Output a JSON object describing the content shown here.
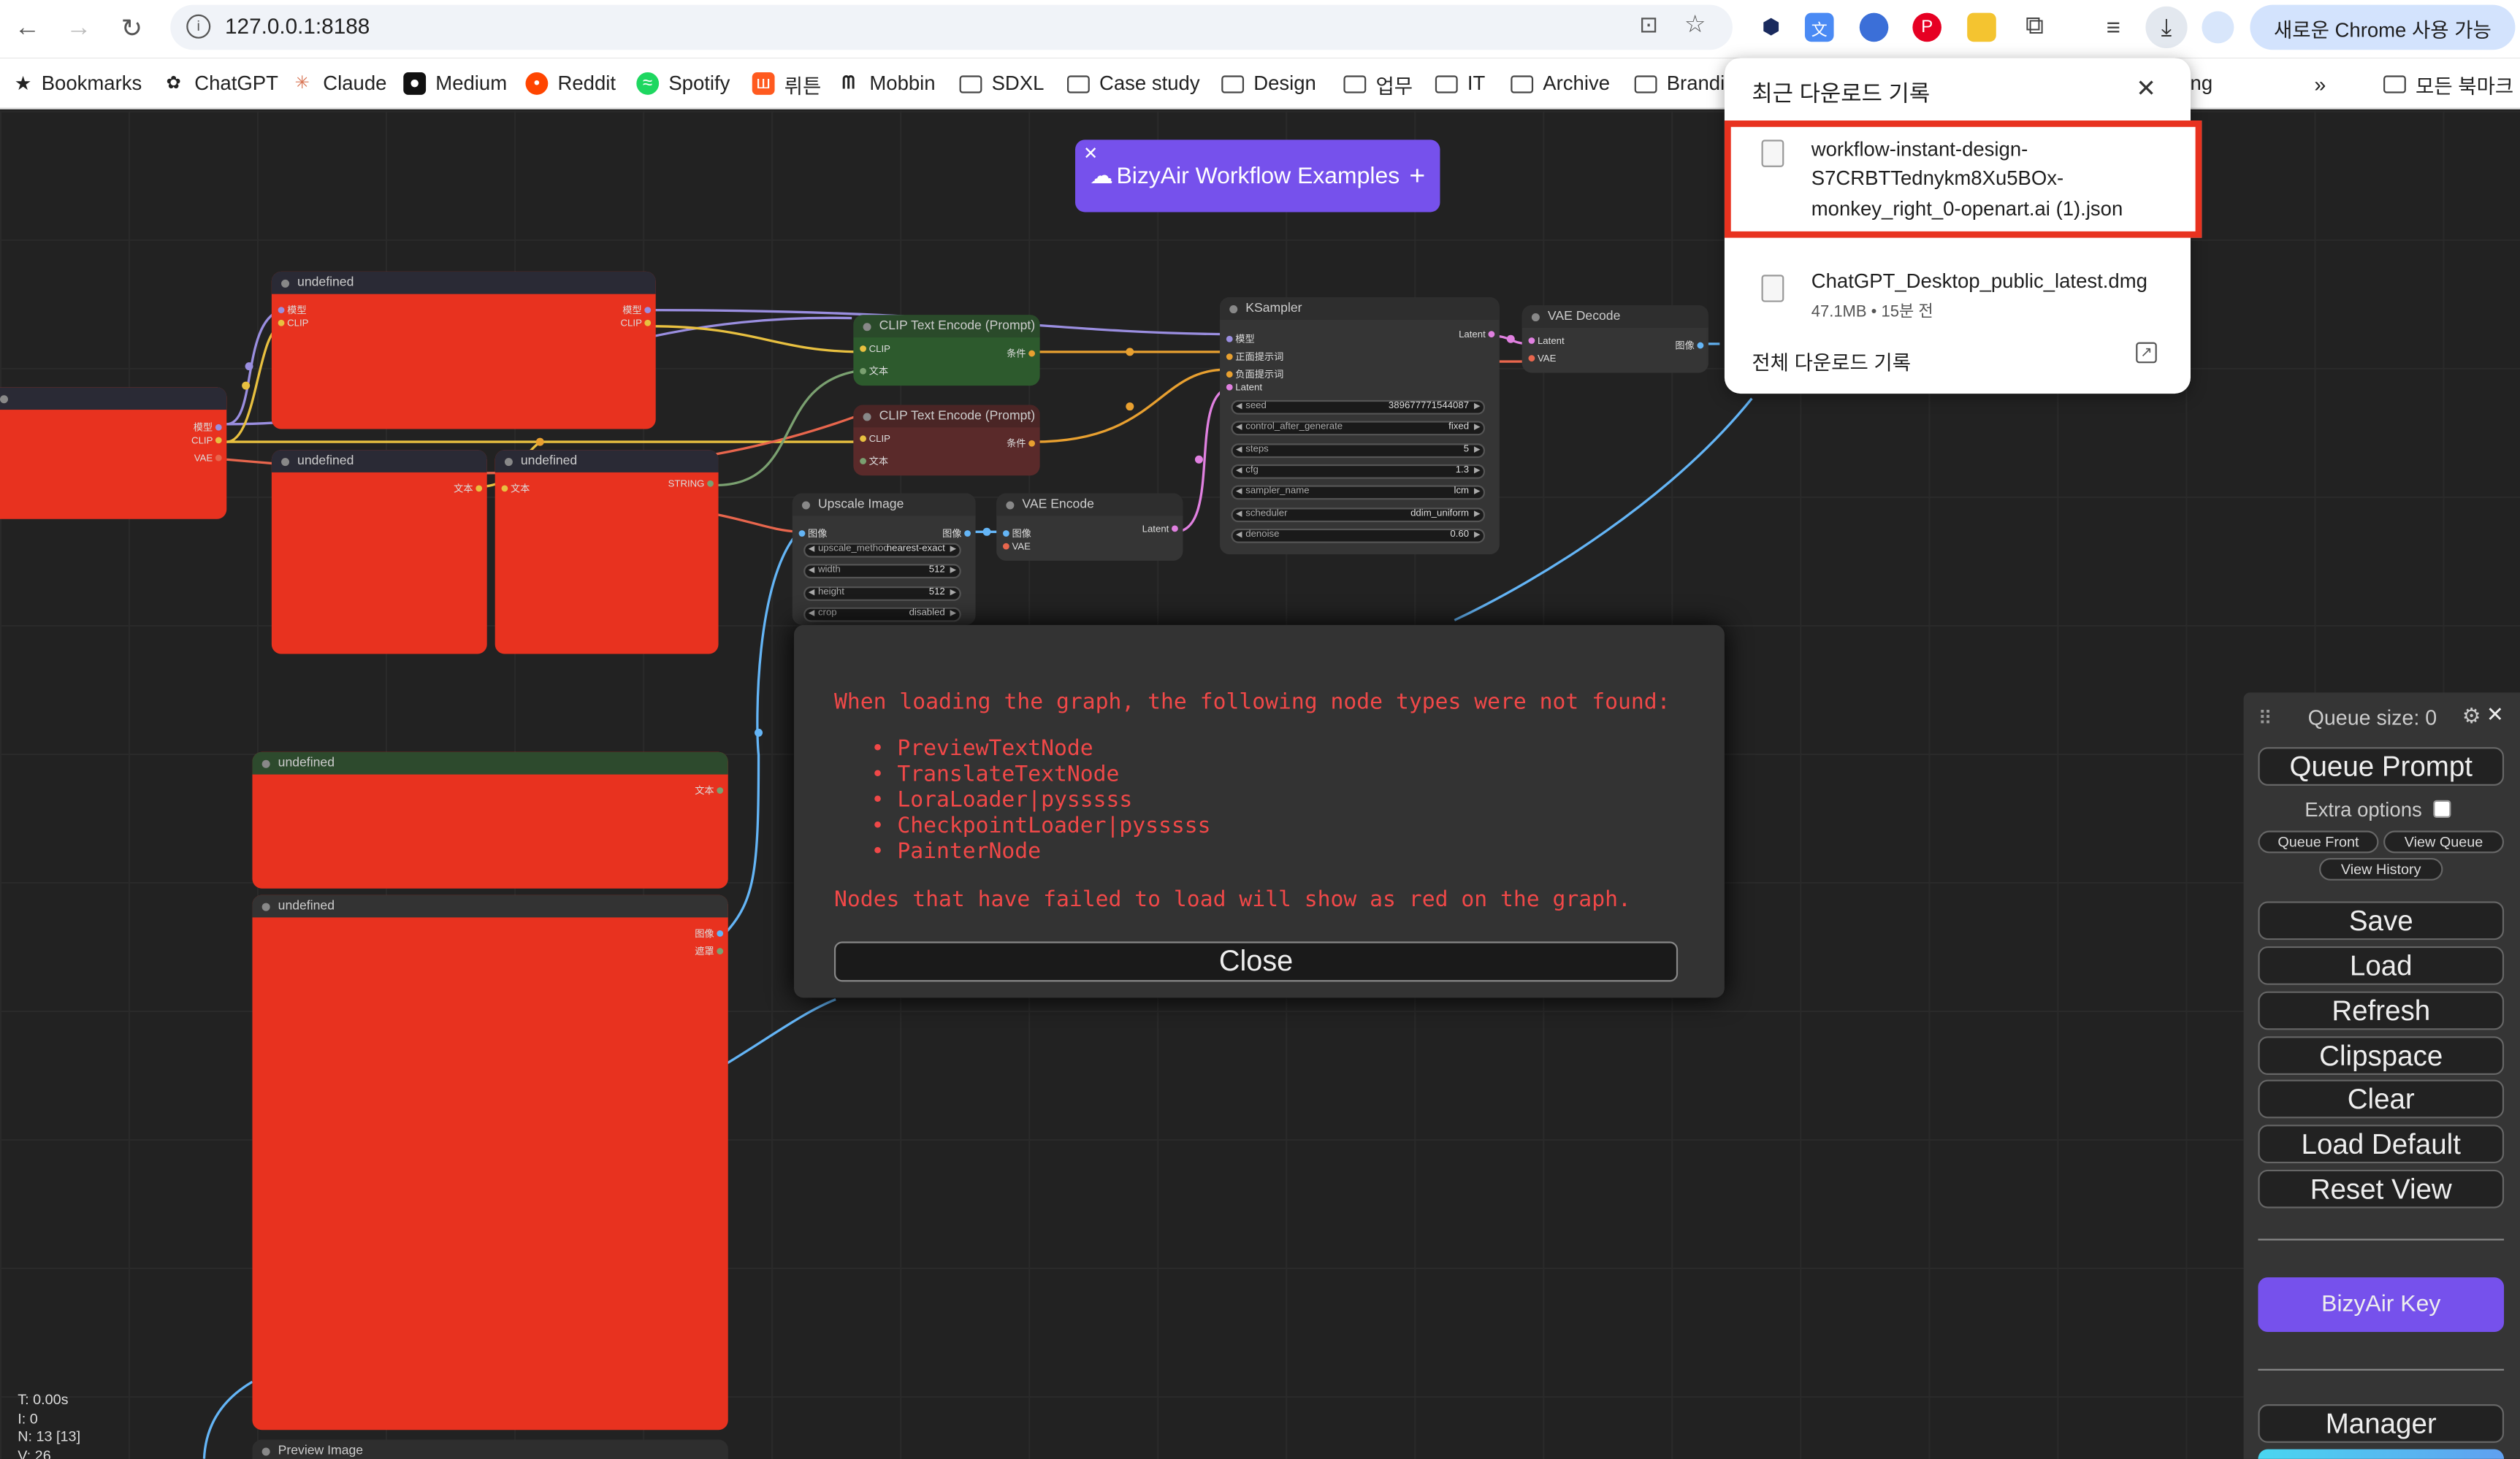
{
  "browser": {
    "url": "127.0.0.1:8188",
    "profile_button": "새로운 Chrome 사용 가능",
    "all_bookmarks": "모든 북마크",
    "bookmarks": [
      "Bookmarks",
      "ChatGPT",
      "Claude",
      "Medium",
      "Reddit",
      "Spotify",
      "뤼튼",
      "Mobbin",
      "SDXL",
      "Case study",
      "Design",
      "업무",
      "IT",
      "Archive",
      "Brandi",
      "ing"
    ]
  },
  "downloads": {
    "title": "최근 다운로드 기록",
    "items": [
      {
        "name_line1": "workflow-instant-design-",
        "name_line2": "S7CRBTTednykm8Xu5BOx-",
        "name_line3": "monkey_right_0-openart.ai (1).json",
        "meta": ""
      },
      {
        "name_line1": "ChatGPT_Desktop_public_latest.dmg",
        "meta": "47.1MB • 15분 전"
      }
    ],
    "all_history": "전체 다운로드 기록",
    "highlight_color": "#e8321f"
  },
  "bizyair": {
    "label": "BizyAir Workflow Examples"
  },
  "nodes": {
    "undef": "undefined",
    "clip_encode": "CLIP Text Encode (Prompt)",
    "ksampler": "KSampler",
    "vae_decode": "VAE Decode",
    "upscale": "Upscale Image",
    "vae_encode": "VAE Encode",
    "preview": "Preview Image",
    "model_port": "模型",
    "clip_port": "CLIP",
    "vae_port": "VAE",
    "text_port": "文本",
    "string_port": "STRING",
    "cond_port": "条件",
    "image_port": "图像",
    "mask_port": "遮罩",
    "latent_port": "Latent",
    "pos_port": "正面提示词",
    "neg_port": "负面提示词",
    "ks_widgets": [
      {
        "label": "seed",
        "value": "389677771544087"
      },
      {
        "label": "control_after_generate",
        "value": "fixed"
      },
      {
        "label": "steps",
        "value": "5"
      },
      {
        "label": "cfg",
        "value": "1.3"
      },
      {
        "label": "sampler_name",
        "value": "lcm"
      },
      {
        "label": "scheduler",
        "value": "ddim_uniform"
      },
      {
        "label": "denoise",
        "value": "0.60"
      }
    ],
    "up_widgets": [
      {
        "label": "upscale_method",
        "value": "nearest-exact"
      },
      {
        "label": "width",
        "value": "512"
      },
      {
        "label": "height",
        "value": "512"
      },
      {
        "label": "crop",
        "value": "disabled"
      }
    ]
  },
  "modal": {
    "intro": "When loading the graph, the following node types were not found:",
    "missing": [
      "PreviewTextNode",
      "TranslateTextNode",
      "LoraLoader|pysssss",
      "CheckpointLoader|pysssss",
      "PainterNode"
    ],
    "footer": "Nodes that have failed to load will show as red on the graph.",
    "close": "Close"
  },
  "panel": {
    "queue_size": "Queue size: 0",
    "queue_prompt": "Queue Prompt",
    "extra_options": "Extra options",
    "queue_front": "Queue Front",
    "view_queue": "View Queue",
    "view_history": "View History",
    "save": "Save",
    "load": "Load",
    "refresh": "Refresh",
    "clipspace": "Clipspace",
    "clear": "Clear",
    "load_default": "Load Default",
    "reset_view": "Reset View",
    "bizyair_key": "BizyAir Key",
    "manager": "Manager"
  },
  "stats": {
    "t": "T: 0.00s",
    "i": "I: 0",
    "n": "N: 13 [13]",
    "v": "V: 26"
  }
}
